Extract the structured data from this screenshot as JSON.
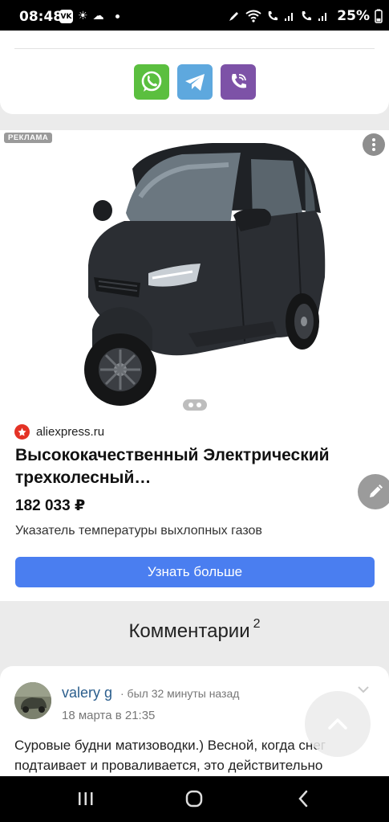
{
  "status_bar": {
    "time": "08:48",
    "vk_label": "VK",
    "battery": "25%"
  },
  "share": {
    "buttons": [
      {
        "name": "whatsapp-icon",
        "color": "#5bbf3f"
      },
      {
        "name": "telegram-icon",
        "color": "#5ea8de"
      },
      {
        "name": "viber-icon",
        "color": "#7d52a7"
      }
    ]
  },
  "ad": {
    "badge": "РЕКЛАМА",
    "seller": "aliexpress.ru",
    "title": "Высококачественный Электрический трехколесный…",
    "price": "182 033 ₽",
    "description": "Указатель температуры выхлопных газов",
    "button_label": "Узнать больше",
    "accent_color": "#4a7ef0"
  },
  "comments": {
    "title": "Комментарии",
    "count": "2",
    "items": [
      {
        "user": "valery g",
        "meta": "· был 32 минуты назад",
        "date": "18 марта в 21:35",
        "text": "Суровые будни матизоводки.) Весной, когда снег подтаивает и проваливается, это действительно"
      }
    ]
  }
}
